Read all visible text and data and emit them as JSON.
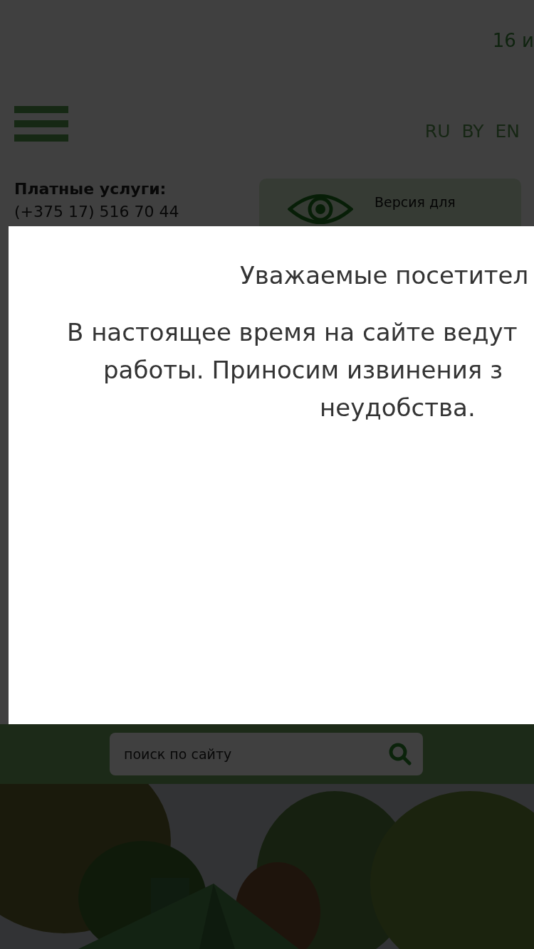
{
  "header": {
    "date": "16 и",
    "languages": [
      {
        "label": "RU"
      },
      {
        "label": "BY"
      },
      {
        "label": "EN"
      }
    ]
  },
  "contacts": {
    "label": "Платные услуги:",
    "phone": "(+375 17) 516 70 44"
  },
  "accessibility": {
    "lines": [
      "Версия для"
    ]
  },
  "modal": {
    "title": "Уважаемые посетител",
    "lines": [
      "В настоящее время на сайте ведут",
      "работы. Приносим извинения з",
      "неудобства."
    ]
  },
  "search": {
    "placeholder": "поиск по сайту"
  }
}
